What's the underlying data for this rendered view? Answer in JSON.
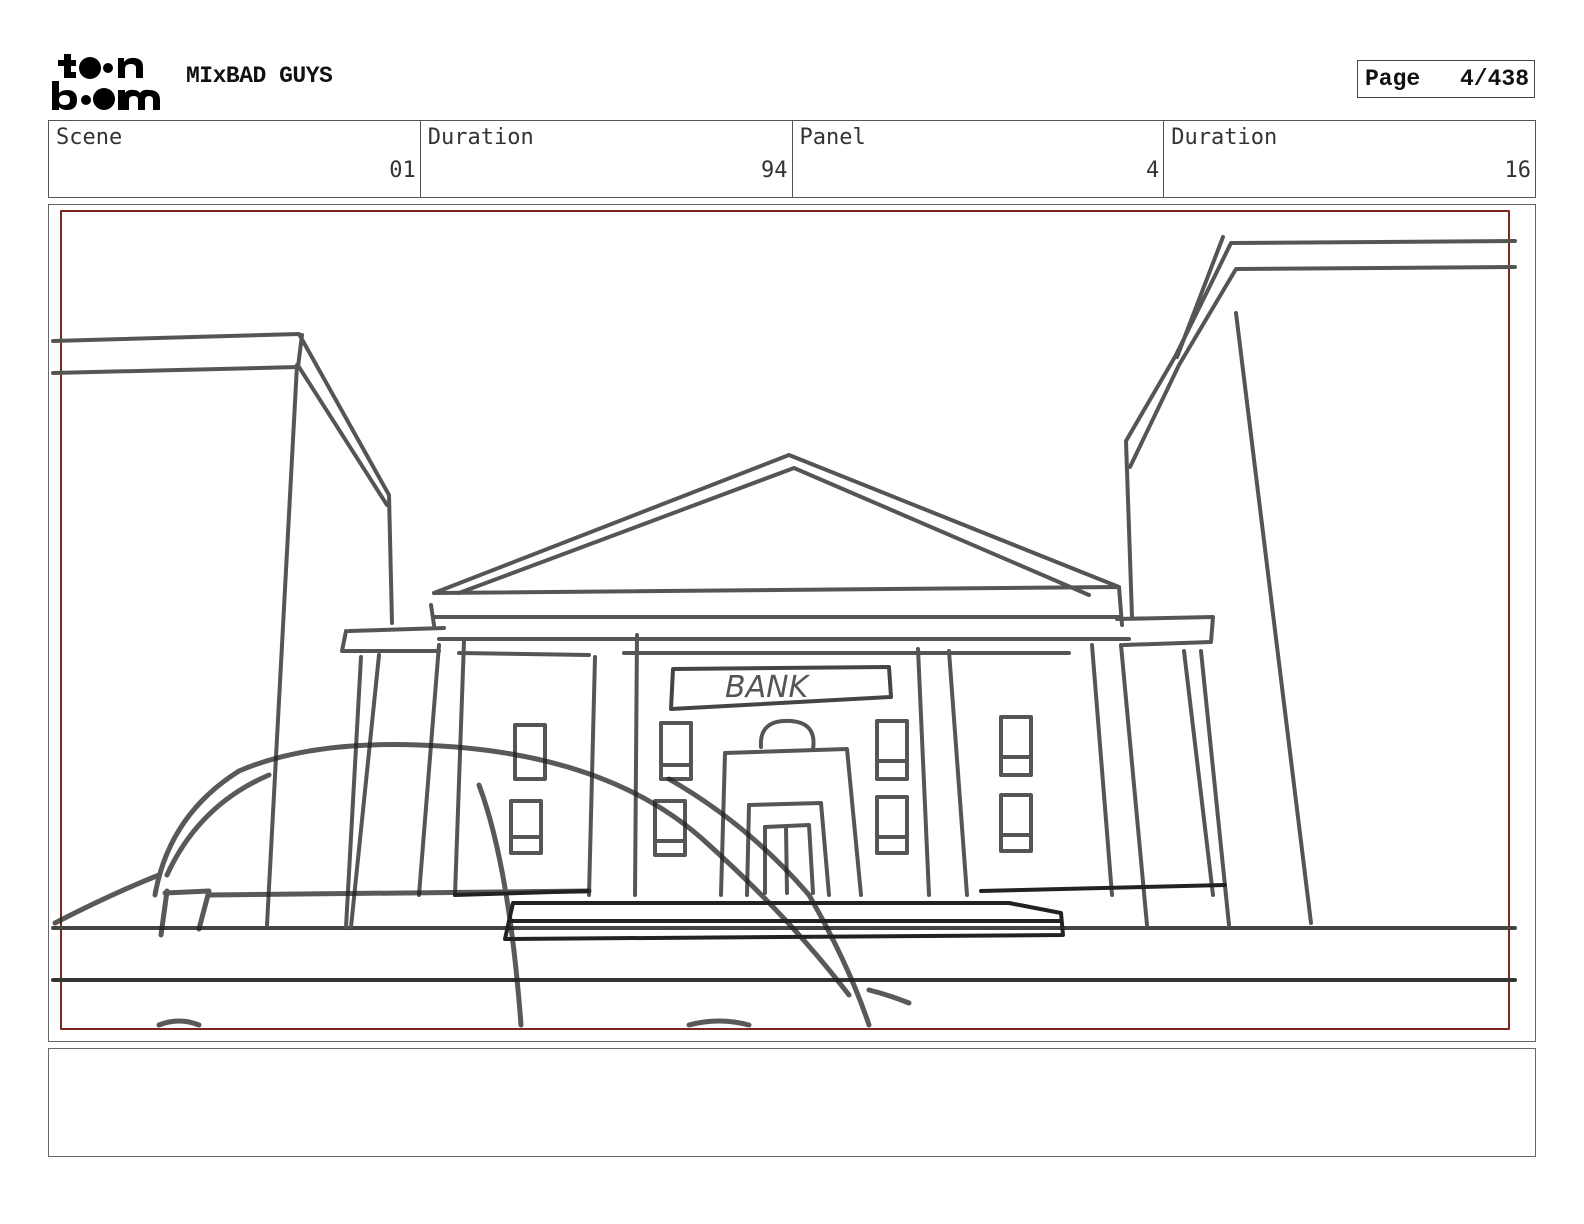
{
  "header": {
    "logo_text": "toon boom",
    "project_title": "MIxBAD GUYS",
    "page_label": "Page",
    "page_value": "4/438"
  },
  "info": {
    "scene_label": "Scene",
    "scene_value": "01",
    "scene_duration_label": "Duration",
    "scene_duration_value": "94",
    "panel_label": "Panel",
    "panel_value": "4",
    "panel_duration_label": "Duration",
    "panel_duration_value": "16"
  },
  "panel": {
    "sign_text": "BANK"
  },
  "notes": {
    "text": ""
  }
}
